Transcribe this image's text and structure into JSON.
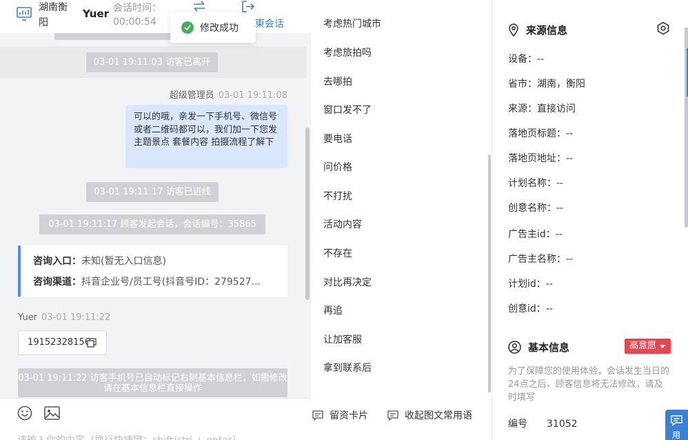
{
  "header": {
    "region": "湖南衡阳",
    "visitor_name": "Yuer",
    "time_label": "会话时间：",
    "time_value": "00:00:54",
    "end_label": "東会话"
  },
  "toast": {
    "text": "修改成功"
  },
  "messages": {
    "sys_leave": "03-01 19:11:03 访客已离开",
    "admin_name": "超级管理员",
    "admin_time": "03-01 19:11:08",
    "agent_text": "可以的哦，亲发一下手机号、微信号或者二维码都可以，我们加一下您发主题景点 套餐内容 拍摄流程了解下",
    "sys_enter": "03-01 19:11:17 访客已进线",
    "sys_start": "03-01 19:11:17 顾客发起会话，会话编号：35865",
    "card": {
      "entry_label": "咨询入口：",
      "entry_value": "未知(暂无入口信息)",
      "channel_label": "咨询渠道：",
      "channel_value": "抖音企业号/员工号(抖音号ID：279527..."
    },
    "visitor_name": "Yuer",
    "visitor_time": "03-01 19:11:22",
    "phone": "19152328156",
    "sys_auto": "03-01 19:11:22 访客手机号已自动标记右侧基本信息栏，如需修改请在基本信息栏直接操作"
  },
  "composer": {
    "placeholder": "请输入你的内容（换行快捷键：shift/ctrl + enter）"
  },
  "quick_replies": {
    "items": [
      "考虑热门城市",
      "考虑旅拍吗",
      "去哪拍",
      "窗口发不了",
      "要电话",
      "问价格",
      "不打扰",
      "活动内容",
      "不存在",
      "对比再决定",
      "再追",
      "让加客服",
      "拿到联系后"
    ],
    "btn_card": "留资卡片",
    "btn_collapse": "收起图文常用语"
  },
  "source_info": {
    "title": "来源信息",
    "rows": [
      "设备：--",
      "省市：湖南，衡阳",
      "来源：直接访问",
      "落地页标题：--",
      "落地页地址：--",
      "计划名称：--",
      "创意名称：--",
      "广告主id：--",
      "广告主名称：--",
      "计划id：--",
      "创意id：--"
    ]
  },
  "basic_info": {
    "title": "基本信息",
    "badge": "高意愿",
    "note": "为了保障您的使用体验，会话发生当日的24点之后，顾客信息将无法修改，请及时填写",
    "id_label": "编号",
    "id_value": "31052"
  },
  "float_button": {
    "label": "用"
  },
  "colors": {
    "accent": "#3b82d6",
    "success": "#3fb15a",
    "badge": "#e84550",
    "agent_bubble": "#d9e7fb",
    "system": "#cfd1d4"
  },
  "icons": [
    "monitor-icon",
    "transfer-icon",
    "exit-icon",
    "check-icon",
    "copy-icon",
    "emoji-icon",
    "image-icon",
    "message-card-icon",
    "message-collapse-icon",
    "location-icon",
    "settings-icon",
    "user-icon",
    "chat-icon"
  ]
}
